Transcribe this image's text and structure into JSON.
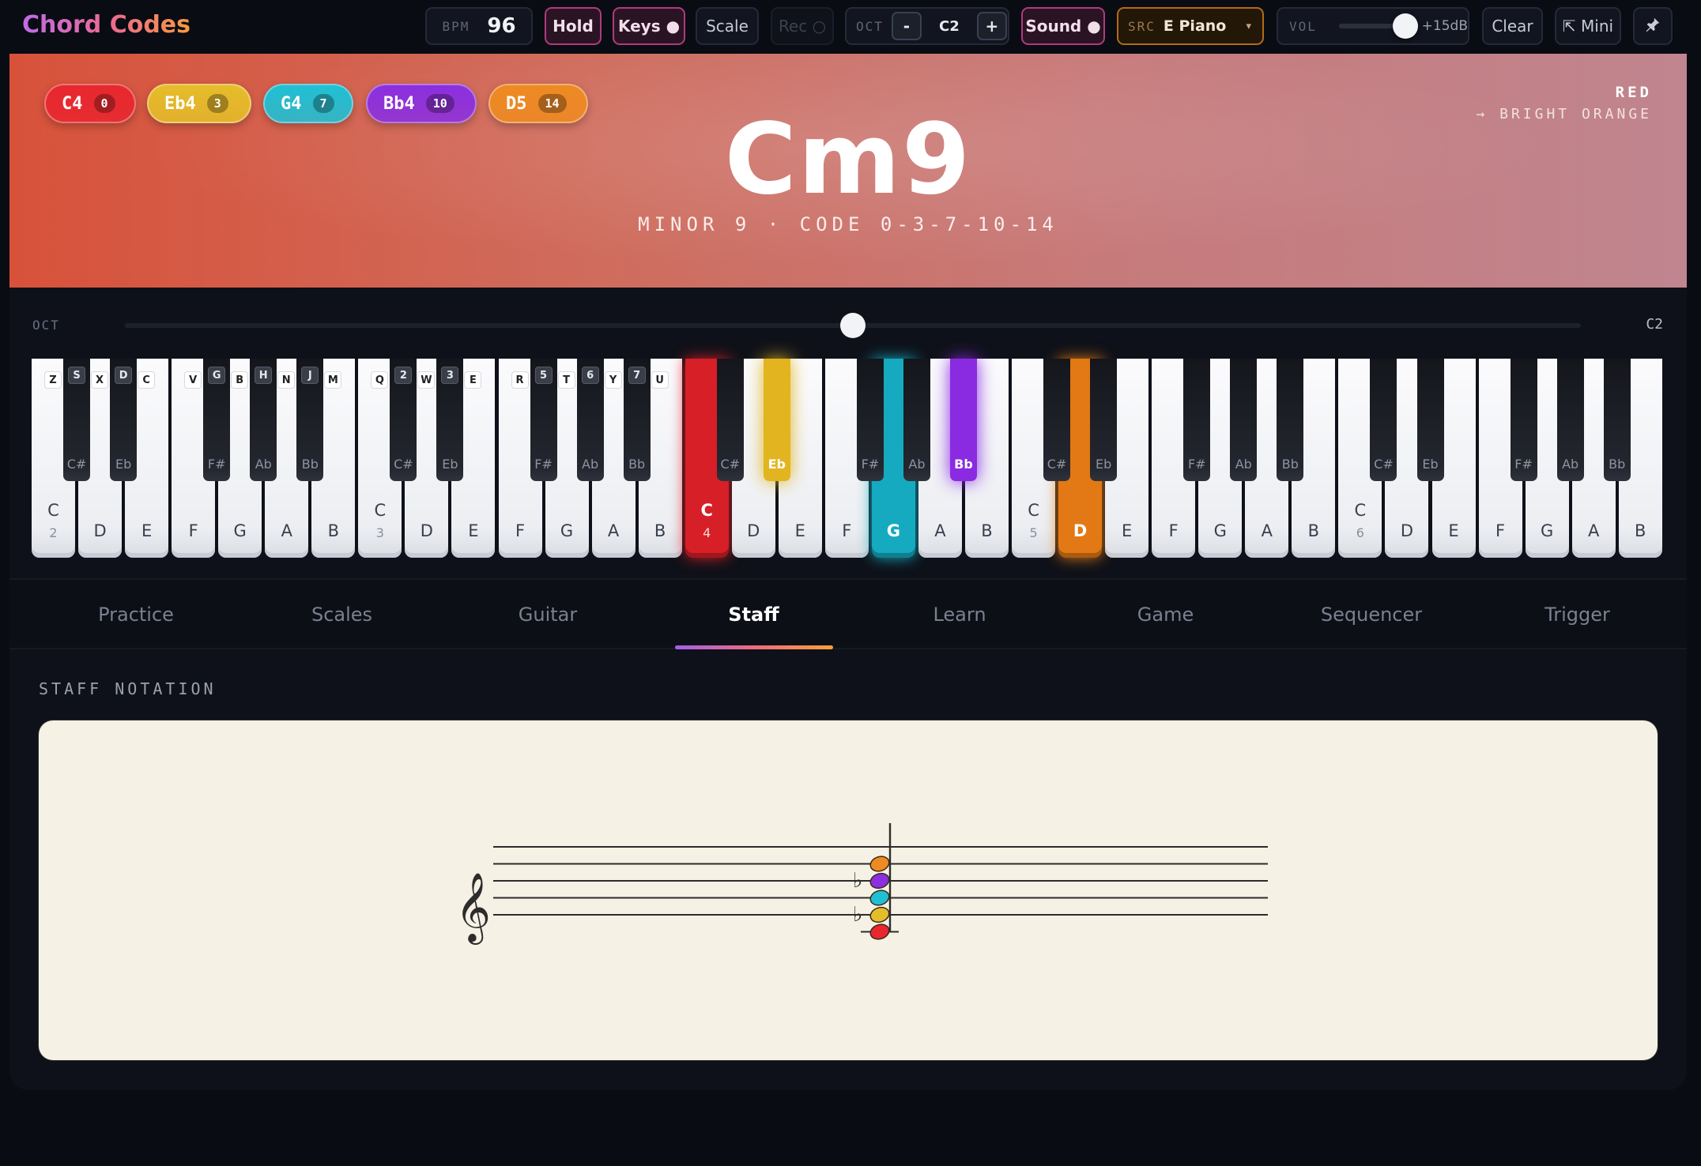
{
  "app": {
    "title": "Chord Codes"
  },
  "toolbar": {
    "bpm_label": "BPM",
    "bpm_value": "96",
    "hold_label": "Hold",
    "keys_label": "Keys ●",
    "scale_label": "Scale",
    "rec_label": "Rec ○",
    "oct_label": "OCT",
    "oct_minus": "-",
    "oct_value": "C2",
    "oct_plus": "+",
    "sound_label": "Sound ●",
    "src_label": "SRC",
    "src_value": "E Piano",
    "src_caret": "▾",
    "vol_label": "VOL",
    "vol_value": "+15dB",
    "vol_level": 0.7,
    "clear_label": "Clear",
    "mini_label": "⇱ Mini",
    "pin_icon": "pin-icon"
  },
  "chord": {
    "name": "Cm9",
    "subtitle": "MINOR 9 · CODE 0-3-7-10-14",
    "color_primary": "RED",
    "color_secondary": "→ BRIGHT ORANGE",
    "notes": [
      {
        "label": "C4",
        "interval": "0",
        "color": "#e8272f"
      },
      {
        "label": "Eb4",
        "interval": "3",
        "color": "#e5bd2a"
      },
      {
        "label": "G4",
        "interval": "7",
        "color": "#1fc0d4"
      },
      {
        "label": "Bb4",
        "interval": "10",
        "color": "#8b2fe0"
      },
      {
        "label": "D5",
        "interval": "14",
        "color": "#ee8a22"
      }
    ]
  },
  "keyboard": {
    "oct_label": "OCT",
    "oct_value": "C2",
    "oct_position": 0.5,
    "white_keys": [
      {
        "note": "C",
        "octave": "2",
        "hint": "Z"
      },
      {
        "note": "D",
        "hint": "X"
      },
      {
        "note": "E",
        "hint": "C"
      },
      {
        "note": "F",
        "hint": "V"
      },
      {
        "note": "G",
        "hint": "B"
      },
      {
        "note": "A",
        "hint": "N"
      },
      {
        "note": "B",
        "hint": "M"
      },
      {
        "note": "C",
        "octave": "3",
        "hint": "Q"
      },
      {
        "note": "D",
        "hint": "W"
      },
      {
        "note": "E",
        "hint": "E"
      },
      {
        "note": "F",
        "hint": "R"
      },
      {
        "note": "G",
        "hint": "T"
      },
      {
        "note": "A",
        "hint": "Y"
      },
      {
        "note": "B",
        "hint": "U"
      },
      {
        "note": "C",
        "octave": "4",
        "active": "#d61f26"
      },
      {
        "note": "D"
      },
      {
        "note": "E"
      },
      {
        "note": "F"
      },
      {
        "note": "G",
        "active": "#15aabf"
      },
      {
        "note": "A"
      },
      {
        "note": "B"
      },
      {
        "note": "C",
        "octave": "5"
      },
      {
        "note": "D",
        "active": "#e27914"
      },
      {
        "note": "E"
      },
      {
        "note": "F"
      },
      {
        "note": "G"
      },
      {
        "note": "A"
      },
      {
        "note": "B"
      },
      {
        "note": "C",
        "octave": "6"
      },
      {
        "note": "D"
      },
      {
        "note": "E"
      },
      {
        "note": "F"
      },
      {
        "note": "G"
      },
      {
        "note": "A"
      },
      {
        "note": "B"
      }
    ],
    "black_keys": [
      {
        "after": 0,
        "note": "C#",
        "hint": "S"
      },
      {
        "after": 1,
        "note": "Eb",
        "hint": "D"
      },
      {
        "after": 3,
        "note": "F#",
        "hint": "G"
      },
      {
        "after": 4,
        "note": "Ab",
        "hint": "H"
      },
      {
        "after": 5,
        "note": "Bb",
        "hint": "J"
      },
      {
        "after": 7,
        "note": "C#",
        "hint": "2"
      },
      {
        "after": 8,
        "note": "Eb",
        "hint": "3"
      },
      {
        "after": 10,
        "note": "F#",
        "hint": "5"
      },
      {
        "after": 11,
        "note": "Ab",
        "hint": "6"
      },
      {
        "after": 12,
        "note": "Bb",
        "hint": "7"
      },
      {
        "after": 14,
        "note": "C#"
      },
      {
        "after": 15,
        "note": "Eb",
        "active": "#e2b520"
      },
      {
        "after": 17,
        "note": "F#"
      },
      {
        "after": 18,
        "note": "Ab"
      },
      {
        "after": 19,
        "note": "Bb",
        "active": "#8a2be2"
      },
      {
        "after": 21,
        "note": "C#"
      },
      {
        "after": 22,
        "note": "Eb"
      },
      {
        "after": 24,
        "note": "F#"
      },
      {
        "after": 25,
        "note": "Ab"
      },
      {
        "after": 26,
        "note": "Bb"
      },
      {
        "after": 28,
        "note": "C#"
      },
      {
        "after": 29,
        "note": "Eb"
      },
      {
        "after": 31,
        "note": "F#"
      },
      {
        "after": 32,
        "note": "Ab"
      },
      {
        "after": 33,
        "note": "Bb"
      }
    ]
  },
  "tabs": [
    {
      "label": "Practice"
    },
    {
      "label": "Scales"
    },
    {
      "label": "Guitar"
    },
    {
      "label": "Staff",
      "active": true
    },
    {
      "label": "Learn"
    },
    {
      "label": "Game"
    },
    {
      "label": "Sequencer"
    },
    {
      "label": "Trigger"
    }
  ],
  "staff": {
    "title": "STAFF NOTATION",
    "clef": "𝄞",
    "flat_symbol": "♭",
    "notes": [
      {
        "step": 0,
        "color": "#e8272f",
        "flat": false
      },
      {
        "step": 2,
        "color": "#e5bd2a",
        "flat": true
      },
      {
        "step": 4,
        "color": "#1fc0d4",
        "flat": false
      },
      {
        "step": 6,
        "color": "#8b2fe0",
        "flat": true
      },
      {
        "step": 8,
        "color": "#ee8a22",
        "flat": false
      }
    ]
  }
}
